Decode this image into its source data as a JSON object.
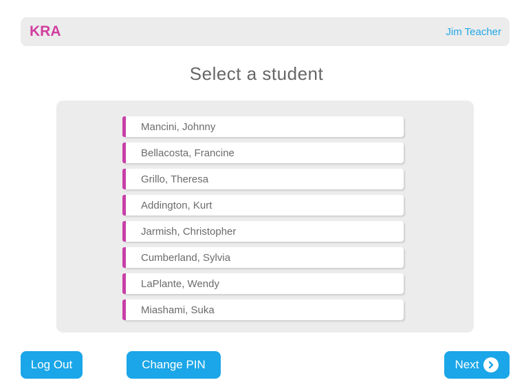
{
  "header": {
    "logo": "KRA",
    "user_name": "Jim Teacher"
  },
  "page": {
    "title": "Select a student"
  },
  "students": [
    {
      "name": "Mancini, Johnny"
    },
    {
      "name": "Bellacosta, Francine"
    },
    {
      "name": "Grillo, Theresa"
    },
    {
      "name": "Addington, Kurt"
    },
    {
      "name": "Jarmish, Christopher"
    },
    {
      "name": "Cumberland, Sylvia"
    },
    {
      "name": "LaPlante, Wendy"
    },
    {
      "name": "Miashami, Suka"
    }
  ],
  "footer": {
    "logout_label": "Log Out",
    "change_pin_label": "Change PIN",
    "next_label": "Next",
    "next_icon": "chevron-right-circle-icon"
  },
  "colors": {
    "brand": "#d13ea0",
    "accent": "#1aa6e8",
    "student_marker": "#c83fa8"
  }
}
